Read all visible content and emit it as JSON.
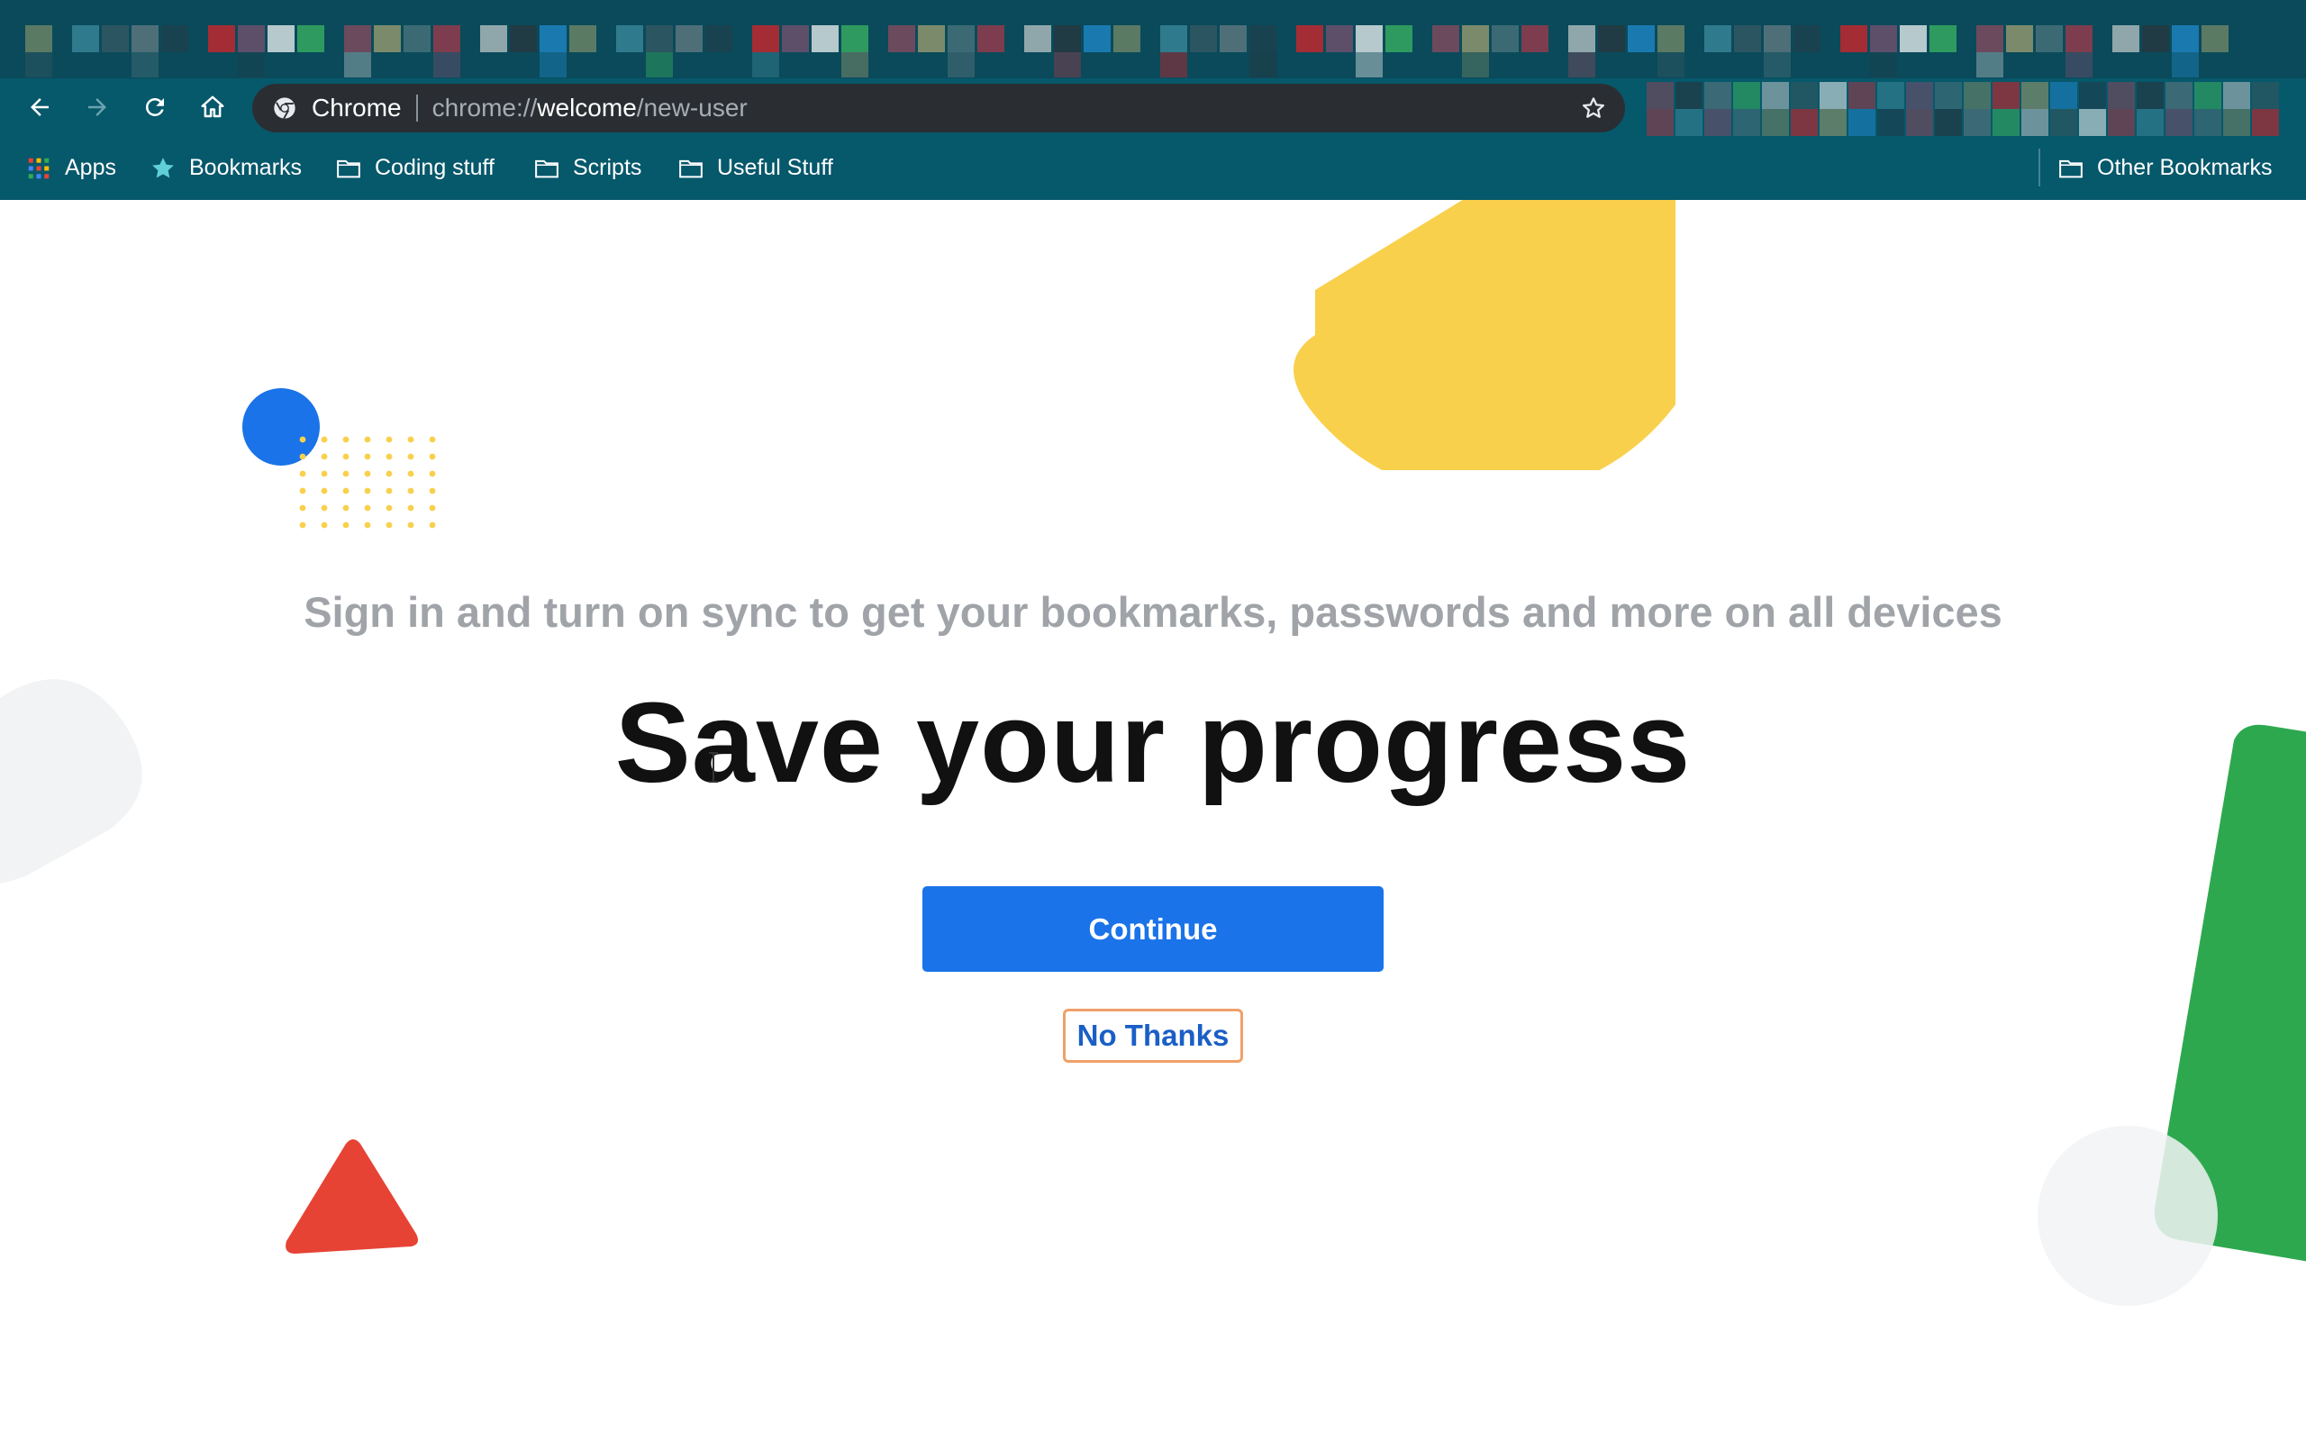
{
  "browser": {
    "toolbar": {
      "back_icon": "arrow-left-icon",
      "forward_icon": "arrow-right-icon",
      "reload_icon": "reload-icon",
      "home_icon": "home-icon"
    },
    "omnibox": {
      "site_name": "Chrome",
      "url_scheme": "chrome://",
      "url_host": "welcome",
      "url_path": "/new-user",
      "bookmark_icon": "star-outline-icon"
    },
    "bookmarks": [
      {
        "label": "Apps",
        "icon": "apps-grid-icon"
      },
      {
        "label": "Bookmarks",
        "icon": "star-icon"
      },
      {
        "label": "Coding stuff",
        "icon": "folder-icon"
      },
      {
        "label": "Scripts",
        "icon": "folder-icon"
      },
      {
        "label": "Useful Stuff",
        "icon": "folder-icon"
      }
    ],
    "other_bookmarks": {
      "label": "Other Bookmarks",
      "icon": "folder-icon"
    },
    "colors": {
      "tabstrip": "#0a4a5a",
      "toolbar": "#06586b",
      "omnibox": "#2a2e33"
    }
  },
  "page": {
    "subtitle": "Sign in and turn on sync to get your bookmarks, passwords and more on all devices",
    "headline": "Save your progress",
    "continue_label": "Continue",
    "no_thanks_label": "No Thanks",
    "colors": {
      "primary_button": "#1a73e8",
      "link": "#1a5fc6",
      "focus_ring": "#f0a068",
      "deco_yellow": "#f9d04c",
      "deco_blue": "#1a73e8",
      "deco_red": "#e64335",
      "deco_green": "#2ea84f",
      "deco_grey": "#f1f3f4"
    }
  }
}
